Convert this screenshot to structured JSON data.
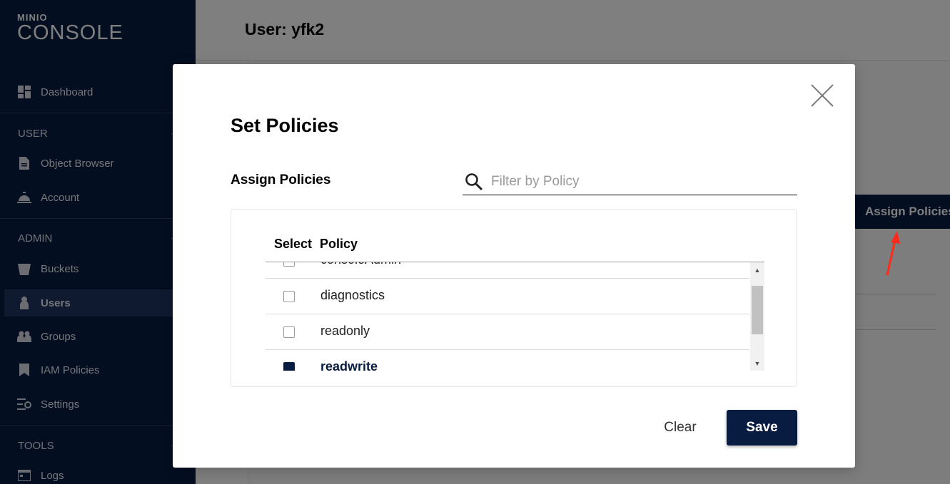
{
  "sidebar": {
    "logo_brand": "MINIO",
    "logo_product": "CONSOLE",
    "dashboard": "Dashboard",
    "section_user": "USER",
    "object_browser": "Object Browser",
    "account": "Account",
    "section_admin": "ADMIN",
    "buckets": "Buckets",
    "users": "Users",
    "groups": "Groups",
    "iam_policies": "IAM Policies",
    "settings": "Settings",
    "section_tools": "TOOLS",
    "logs": "Logs"
  },
  "page": {
    "title": "User: yfk2",
    "assign_policies_button": "Assign Policies"
  },
  "modal": {
    "title": "Set Policies",
    "assign_label": "Assign Policies",
    "search_placeholder": "Filter by Policy",
    "columns": {
      "select": "Select",
      "policy": "Policy"
    },
    "policies": [
      {
        "name": "consoleAdmin",
        "checked": false
      },
      {
        "name": "diagnostics",
        "checked": false
      },
      {
        "name": "readonly",
        "checked": false
      },
      {
        "name": "readwrite",
        "checked": true
      }
    ],
    "clear_label": "Clear",
    "save_label": "Save"
  },
  "colors": {
    "brand": "#081c42",
    "annotation_arrow": "#ff2a1a"
  }
}
